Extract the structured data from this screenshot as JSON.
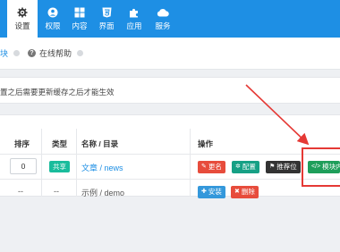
{
  "nav": {
    "items": [
      {
        "label": "设置",
        "icon": "gear-icon"
      },
      {
        "label": "权限",
        "icon": "user-icon"
      },
      {
        "label": "内容",
        "icon": "grid-icon"
      },
      {
        "label": "界面",
        "icon": "html5-icon"
      },
      {
        "label": "应用",
        "icon": "puzzle-icon"
      },
      {
        "label": "服务",
        "icon": "cloud-icon"
      }
    ],
    "active_index": 0
  },
  "tabs": {
    "module": "块",
    "help": "在线帮助",
    "help_icon": "?"
  },
  "notice": "置之后需要更新缓存之后才能生效",
  "table": {
    "headers": {
      "sort": "排序",
      "type": "类型",
      "name": "名称 / 目录",
      "ops": "操作"
    },
    "rows": [
      {
        "sort": "0",
        "type": "共享",
        "name": "文章 / news"
      },
      {
        "sort": "--",
        "type": "--",
        "name": "示例 / demo"
      }
    ]
  },
  "buttons": {
    "rename": "更名",
    "config": "配置",
    "recommend": "推荐位",
    "module_content": "模块内",
    "install": "安装",
    "delete": "删除"
  },
  "colors": {
    "nav_bg": "#1e8fe4",
    "rename": "#e74c3c",
    "config": "#16a085",
    "recommend": "#333333",
    "module_content": "#1e9e5a",
    "install": "#3498db",
    "delete": "#e74c3c",
    "annotation": "#e53935"
  }
}
